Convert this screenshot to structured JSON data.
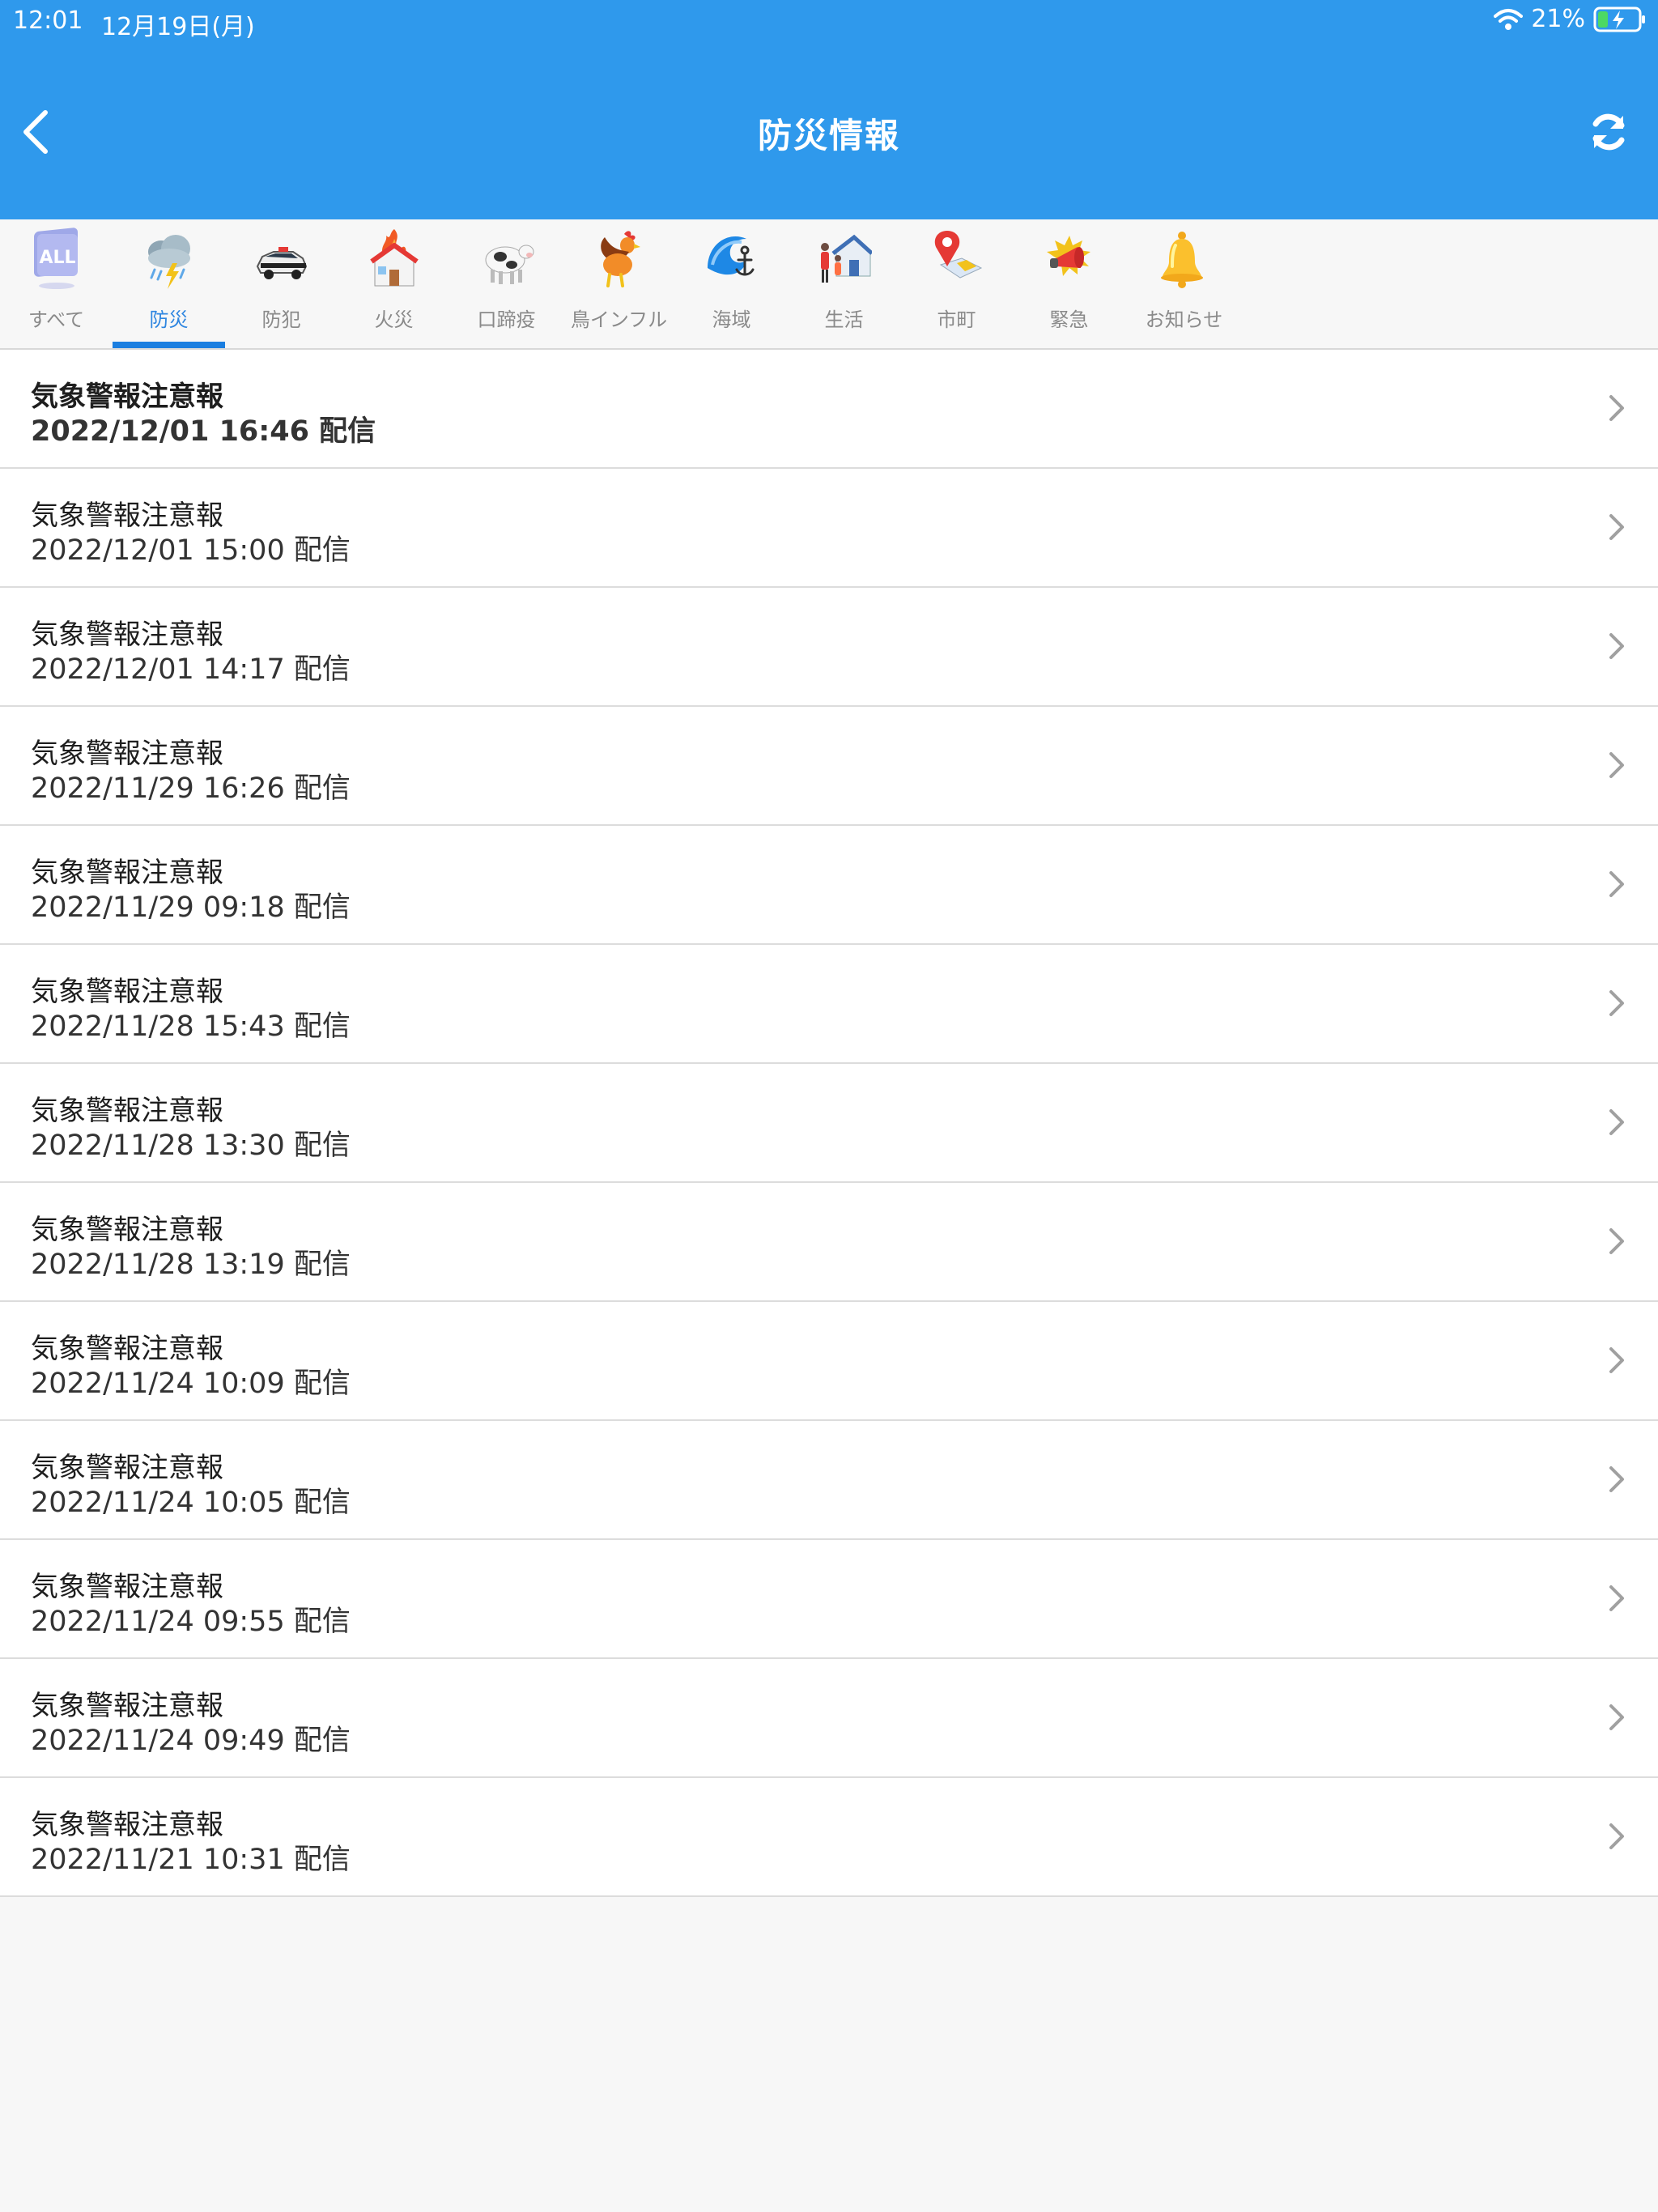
{
  "status_bar": {
    "time": "12:01",
    "date": "12月19日(月)",
    "battery": "21%"
  },
  "header": {
    "title": "防災情報",
    "back_icon": "chevron-left-icon",
    "refresh_icon": "refresh-icon",
    "color": "#2f99ec"
  },
  "tabs": [
    {
      "label": "すべて",
      "icon": "all-icon",
      "active": false
    },
    {
      "label": "防災",
      "icon": "weather-storm-icon",
      "active": true
    },
    {
      "label": "防犯",
      "icon": "police-car-icon",
      "active": false
    },
    {
      "label": "火災",
      "icon": "house-fire-icon",
      "active": false
    },
    {
      "label": "口蹄疫",
      "icon": "cow-icon",
      "active": false
    },
    {
      "label": "鳥インフル",
      "icon": "rooster-icon",
      "active": false
    },
    {
      "label": "海域",
      "icon": "wave-anchor-icon",
      "active": false
    },
    {
      "label": "生活",
      "icon": "family-house-icon",
      "active": false
    },
    {
      "label": "市町",
      "icon": "map-pin-icon",
      "active": false
    },
    {
      "label": "緊急",
      "icon": "megaphone-icon",
      "active": false
    },
    {
      "label": "お知らせ",
      "icon": "bell-icon",
      "active": false
    }
  ],
  "items": [
    {
      "title": "気象警報注意報",
      "date": "2022/12/01 16:46 配信",
      "unread": true
    },
    {
      "title": "気象警報注意報",
      "date": "2022/12/01 15:00 配信",
      "unread": false
    },
    {
      "title": "気象警報注意報",
      "date": "2022/12/01 14:17 配信",
      "unread": false
    },
    {
      "title": "気象警報注意報",
      "date": "2022/11/29 16:26 配信",
      "unread": false
    },
    {
      "title": "気象警報注意報",
      "date": "2022/11/29 09:18 配信",
      "unread": false
    },
    {
      "title": "気象警報注意報",
      "date": "2022/11/28 15:43 配信",
      "unread": false
    },
    {
      "title": "気象警報注意報",
      "date": "2022/11/28 13:30 配信",
      "unread": false
    },
    {
      "title": "気象警報注意報",
      "date": "2022/11/28 13:19 配信",
      "unread": false
    },
    {
      "title": "気象警報注意報",
      "date": "2022/11/24 10:09 配信",
      "unread": false
    },
    {
      "title": "気象警報注意報",
      "date": "2022/11/24 10:05 配信",
      "unread": false
    },
    {
      "title": "気象警報注意報",
      "date": "2022/11/24 09:55 配信",
      "unread": false
    },
    {
      "title": "気象警報注意報",
      "date": "2022/11/24 09:49 配信",
      "unread": false
    },
    {
      "title": "気象警報注意報",
      "date": "2022/11/21 10:31 配信",
      "unread": false
    }
  ]
}
